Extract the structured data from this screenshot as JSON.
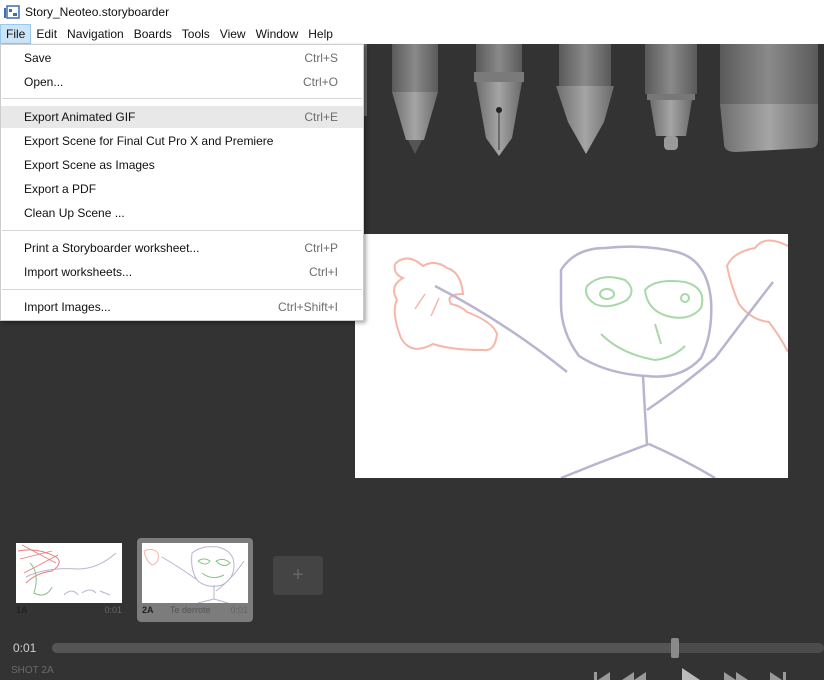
{
  "window": {
    "title": "Story_Neoteo.storyboarder"
  },
  "menubar": {
    "items": [
      "File",
      "Edit",
      "Navigation",
      "Boards",
      "Tools",
      "View",
      "Window",
      "Help"
    ]
  },
  "file_menu": {
    "items": [
      {
        "label": "Save",
        "shortcut": "Ctrl+S"
      },
      {
        "label": "Open...",
        "shortcut": "Ctrl+O"
      },
      {
        "label": "Export Animated GIF",
        "shortcut": "Ctrl+E"
      },
      {
        "label": "Export Scene for Final Cut Pro X and Premiere",
        "shortcut": ""
      },
      {
        "label": "Export Scene as Images",
        "shortcut": ""
      },
      {
        "label": "Export a PDF",
        "shortcut": ""
      },
      {
        "label": "Clean Up Scene ...",
        "shortcut": ""
      },
      {
        "label": "Print a Storyboarder worksheet...",
        "shortcut": "Ctrl+P"
      },
      {
        "label": "Import worksheets...",
        "shortcut": "Ctrl+I"
      },
      {
        "label": "Import Images...",
        "shortcut": "Ctrl+Shift+I"
      }
    ]
  },
  "tools": {
    "icons": [
      "pencil-tool-icon",
      "pen-tool-icon",
      "brush-tool-icon",
      "marker-tool-icon",
      "eraser-tool-icon"
    ]
  },
  "boards": [
    {
      "number": "1A",
      "caption": "",
      "duration": "0:01",
      "selected": false
    },
    {
      "number": "2A",
      "caption": "Te derrote",
      "duration": "0:01",
      "selected": true
    }
  ],
  "add_board": {
    "label": "+"
  },
  "timeline": {
    "current_time": "0:01",
    "position": 0.81
  },
  "status": {
    "shot": "SHOT 2A"
  },
  "colors": {
    "background": "#333333",
    "menu_highlight": "#e8e8e8",
    "sketch_blue": "#b9b4cf",
    "sketch_red": "#f4b7a8",
    "sketch_green": "#a8d8a8"
  }
}
